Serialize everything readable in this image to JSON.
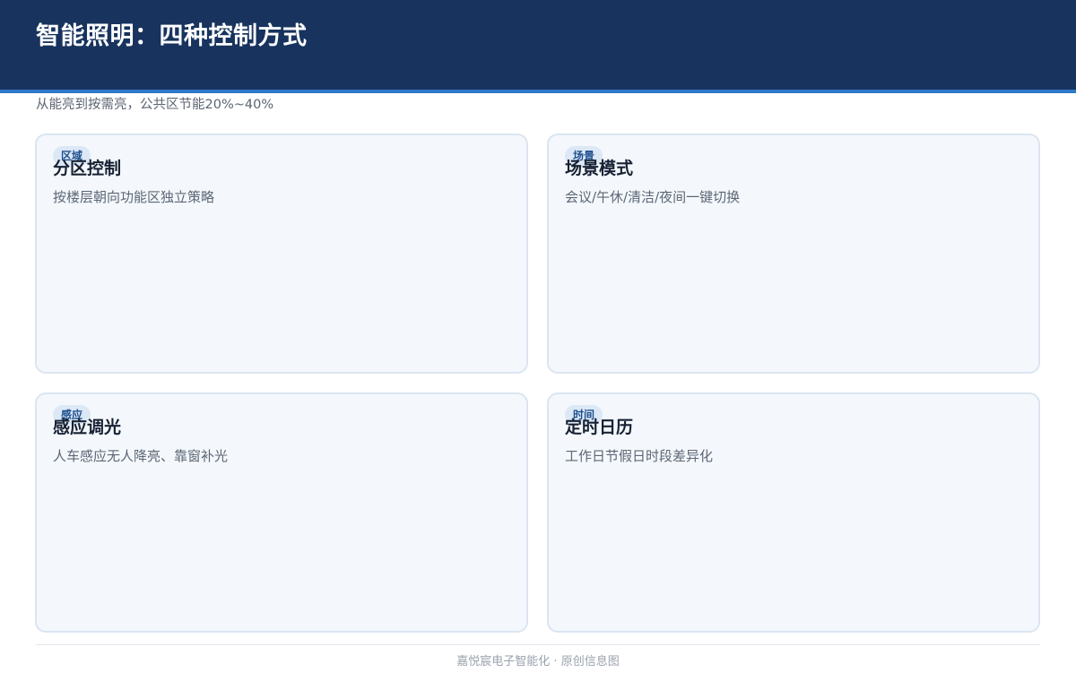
{
  "header": {
    "title": "智能照明：四种控制方式"
  },
  "subtitle": "从能亮到按需亮，公共区节能20%~40%",
  "cards": [
    {
      "tag": "区域",
      "title": "分区控制",
      "desc": "按楼层朝向功能区独立策略"
    },
    {
      "tag": "场景",
      "title": "场景模式",
      "desc": "会议/午休/清洁/夜间一键切换"
    },
    {
      "tag": "感应",
      "title": "感应调光",
      "desc": "人车感应无人降亮、靠窗补光"
    },
    {
      "tag": "时间",
      "title": "定时日历",
      "desc": "工作日节假日时段差异化"
    }
  ],
  "footer": "嘉悦宸电子智能化 · 原创信息图",
  "colors": {
    "header_bg": "#17335e",
    "header_accent": "#2f78c8",
    "card_bg": "#f4f8fc",
    "card_border": "#dbe5f0",
    "tag_bg": "#dce8f6",
    "tag_text": "#1f4f8f"
  }
}
